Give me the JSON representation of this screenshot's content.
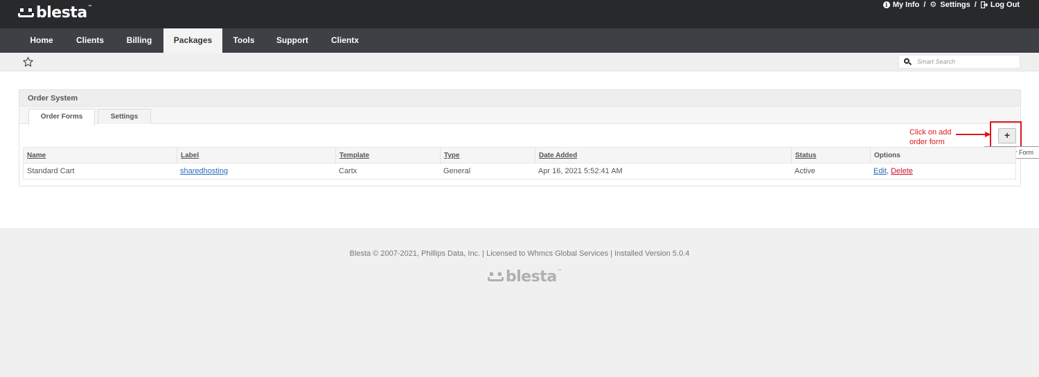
{
  "brand": {
    "logo_text": "blesta",
    "tm": "™"
  },
  "top_links": {
    "my_info": "My Info",
    "settings": "Settings",
    "logout": "Log Out",
    "separator": "/"
  },
  "nav": {
    "items": [
      {
        "label": "Home",
        "active": false
      },
      {
        "label": "Clients",
        "active": false
      },
      {
        "label": "Billing",
        "active": false
      },
      {
        "label": "Packages",
        "active": true
      },
      {
        "label": "Tools",
        "active": false
      },
      {
        "label": "Support",
        "active": false
      },
      {
        "label": "Clientx",
        "active": false
      }
    ]
  },
  "search": {
    "placeholder": "Smart Search"
  },
  "panel": {
    "title": "Order System",
    "tabs": [
      {
        "label": "Order Forms",
        "active": true
      },
      {
        "label": "Settings",
        "active": false
      }
    ],
    "add_button": {
      "label": "+",
      "tooltip": "Add Order Form"
    },
    "table": {
      "headers": [
        "Name",
        "Label",
        "Template",
        "Type",
        "Date Added",
        "Status",
        "Options"
      ],
      "rows": [
        {
          "name": "Standard Cart",
          "label": "sharedhosting",
          "template": "Cartx",
          "type": "General",
          "date_added": "Apr 16, 2021 5:52:41 AM",
          "status": "Active",
          "edit": "Edit",
          "comma": ",",
          "delete": "Delete"
        }
      ]
    }
  },
  "annotation": {
    "line1": "Click on add",
    "line2": "order form",
    "color": "#e0141e"
  },
  "footer": {
    "text": "Blesta © 2007-2021, Phillips Data, Inc. | Licensed to Whmcs Global Services | Installed Version 5.0.4",
    "logo_text": "blesta",
    "tm": "™"
  }
}
